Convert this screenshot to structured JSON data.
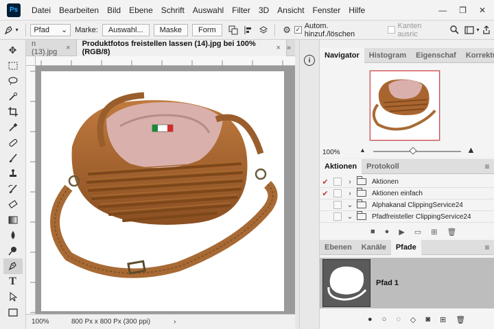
{
  "app": {
    "logo": "Ps"
  },
  "menu": [
    "Datei",
    "Bearbeiten",
    "Bild",
    "Ebene",
    "Schrift",
    "Auswahl",
    "Filter",
    "3D",
    "Ansicht",
    "Fenster",
    "Hilfe"
  ],
  "window_controls": {
    "minimize": "—",
    "restore": "❐",
    "close": "✕"
  },
  "options": {
    "mode_value": "Pfad",
    "marke_label": "Marke:",
    "selection_button": "Auswahl...",
    "mask_button": "Maske",
    "shape_button": "Form",
    "auto_add_label": "Autom. hinzuf./löschen",
    "auto_add_checked": true,
    "align_edges_label": "Kanten ausric",
    "align_edges_checked": false
  },
  "tools": [
    "move",
    "marquee",
    "lasso",
    "quick-select",
    "crop",
    "eyedropper",
    "healing",
    "brush",
    "stamp",
    "history-brush",
    "eraser",
    "gradient",
    "blur",
    "dodge",
    "pen",
    "type",
    "path-select",
    "rectangle"
  ],
  "document": {
    "tabs": [
      {
        "label": "n (13).jpg",
        "close": "×"
      },
      {
        "label": "Produktfotos freistellen lassen (14).jpg bei 100% (RGB/8)",
        "close": "×"
      }
    ],
    "tab_scroll": "»",
    "zoom": "100%",
    "size_info": "800 Px x 800 Px (300 ppi)",
    "status_arrow": "›"
  },
  "navigator": {
    "tabs": [
      "Navigator",
      "Histogram",
      "Eigenschaf",
      "Korrekture"
    ],
    "zoom": "100%",
    "slider_value": 0.45
  },
  "actions": {
    "tabs": [
      "Aktionen",
      "Protokoll"
    ],
    "rows": [
      {
        "checked": true,
        "label": "Aktionen",
        "expanded": false
      },
      {
        "checked": true,
        "label": "Aktionen einfach",
        "expanded": false
      },
      {
        "checked": false,
        "label": "Alphakanal ClippingService24",
        "expanded": true
      },
      {
        "checked": false,
        "label": "Pfadfreisteller ClippingService24",
        "expanded": true
      }
    ]
  },
  "paths": {
    "tabs": [
      "Ebenen",
      "Kanäle",
      "Pfade"
    ],
    "items": [
      {
        "name": "Pfad 1"
      }
    ]
  },
  "colors": {
    "accent_red": "#e43b3b",
    "ps_blue": "#31a8ff",
    "ps_dark": "#001e36"
  }
}
